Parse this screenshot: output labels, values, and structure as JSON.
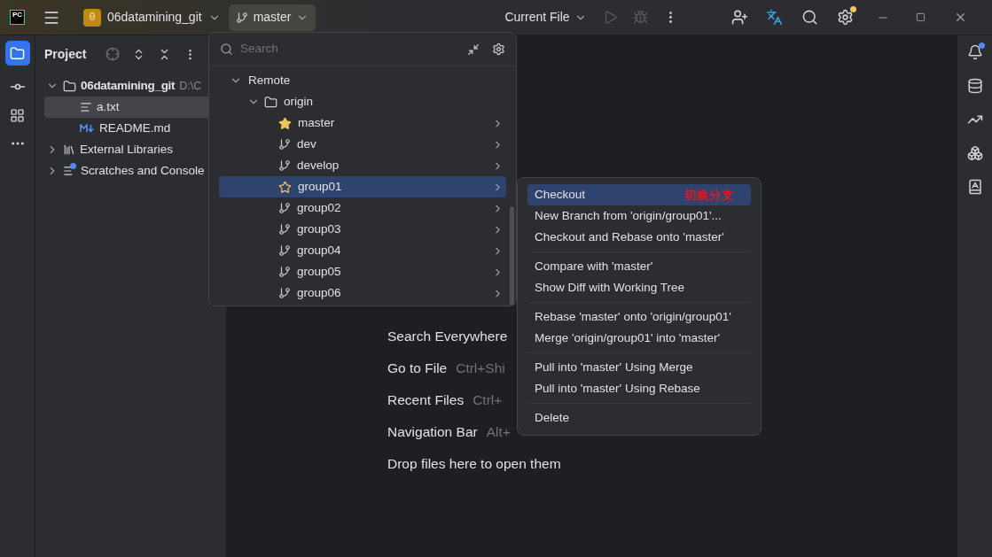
{
  "title_bar": {
    "logo": "PC",
    "project_badge": "0",
    "project": "06datamining_git",
    "branch": "master",
    "run_config": "Current File"
  },
  "project_panel": {
    "title": "Project",
    "tree": [
      {
        "label": "06datamining_git",
        "path": "D:\\C",
        "kind": "folder",
        "expanded": true,
        "selected": false,
        "children": [
          {
            "label": "a.txt",
            "kind": "text",
            "selected": true
          },
          {
            "label": "README.md",
            "kind": "markdown",
            "selected": false
          }
        ]
      },
      {
        "label": "External Libraries",
        "kind": "library",
        "expanded": false,
        "selected": false
      },
      {
        "label": "Scratches and Console",
        "kind": "scratch",
        "expanded": false,
        "selected": false
      }
    ]
  },
  "editor": {
    "hints": [
      {
        "label": "Search Everywhere"
      },
      {
        "label": "Go to File",
        "shortcut": "Ctrl+Shi"
      },
      {
        "label": "Recent Files",
        "shortcut": "Ctrl+"
      },
      {
        "label": "Navigation Bar",
        "shortcut": "Alt+"
      },
      {
        "label": "Drop files here to open them"
      }
    ]
  },
  "branch_popup": {
    "search": {
      "placeholder": "Search"
    },
    "tree": [
      {
        "label": "Remote",
        "expanded": true,
        "children": [
          {
            "label": "origin",
            "expanded": true,
            "children": [
              {
                "label": "master",
                "favorite": true,
                "selected": false
              },
              {
                "label": "dev",
                "favorite": false,
                "selected": false
              },
              {
                "label": "develop",
                "favorite": false,
                "selected": false
              },
              {
                "label": "group01",
                "favorite": false,
                "selected": true
              },
              {
                "label": "group02",
                "favorite": false,
                "selected": false
              },
              {
                "label": "group03",
                "favorite": false,
                "selected": false
              },
              {
                "label": "group04",
                "favorite": false,
                "selected": false
              },
              {
                "label": "group05",
                "favorite": false,
                "selected": false
              },
              {
                "label": "group06",
                "favorite": false,
                "selected": false
              }
            ]
          }
        ]
      }
    ]
  },
  "context_menu": {
    "annotation": "切换分支",
    "groups": [
      [
        {
          "label": "Checkout",
          "selected": true
        },
        {
          "label": "New Branch from 'origin/group01'...",
          "selected": false
        },
        {
          "label": "Checkout and Rebase onto 'master'",
          "selected": false
        }
      ],
      [
        {
          "label": "Compare with 'master'",
          "selected": false
        },
        {
          "label": "Show Diff with Working Tree",
          "selected": false
        }
      ],
      [
        {
          "label": "Rebase 'master' onto 'origin/group01'",
          "selected": false
        },
        {
          "label": "Merge 'origin/group01' into 'master'",
          "selected": false
        }
      ],
      [
        {
          "label": "Pull into 'master' Using Merge",
          "selected": false
        },
        {
          "label": "Pull into 'master' Using Rebase",
          "selected": false
        }
      ],
      [
        {
          "label": "Delete",
          "selected": false
        }
      ]
    ]
  }
}
